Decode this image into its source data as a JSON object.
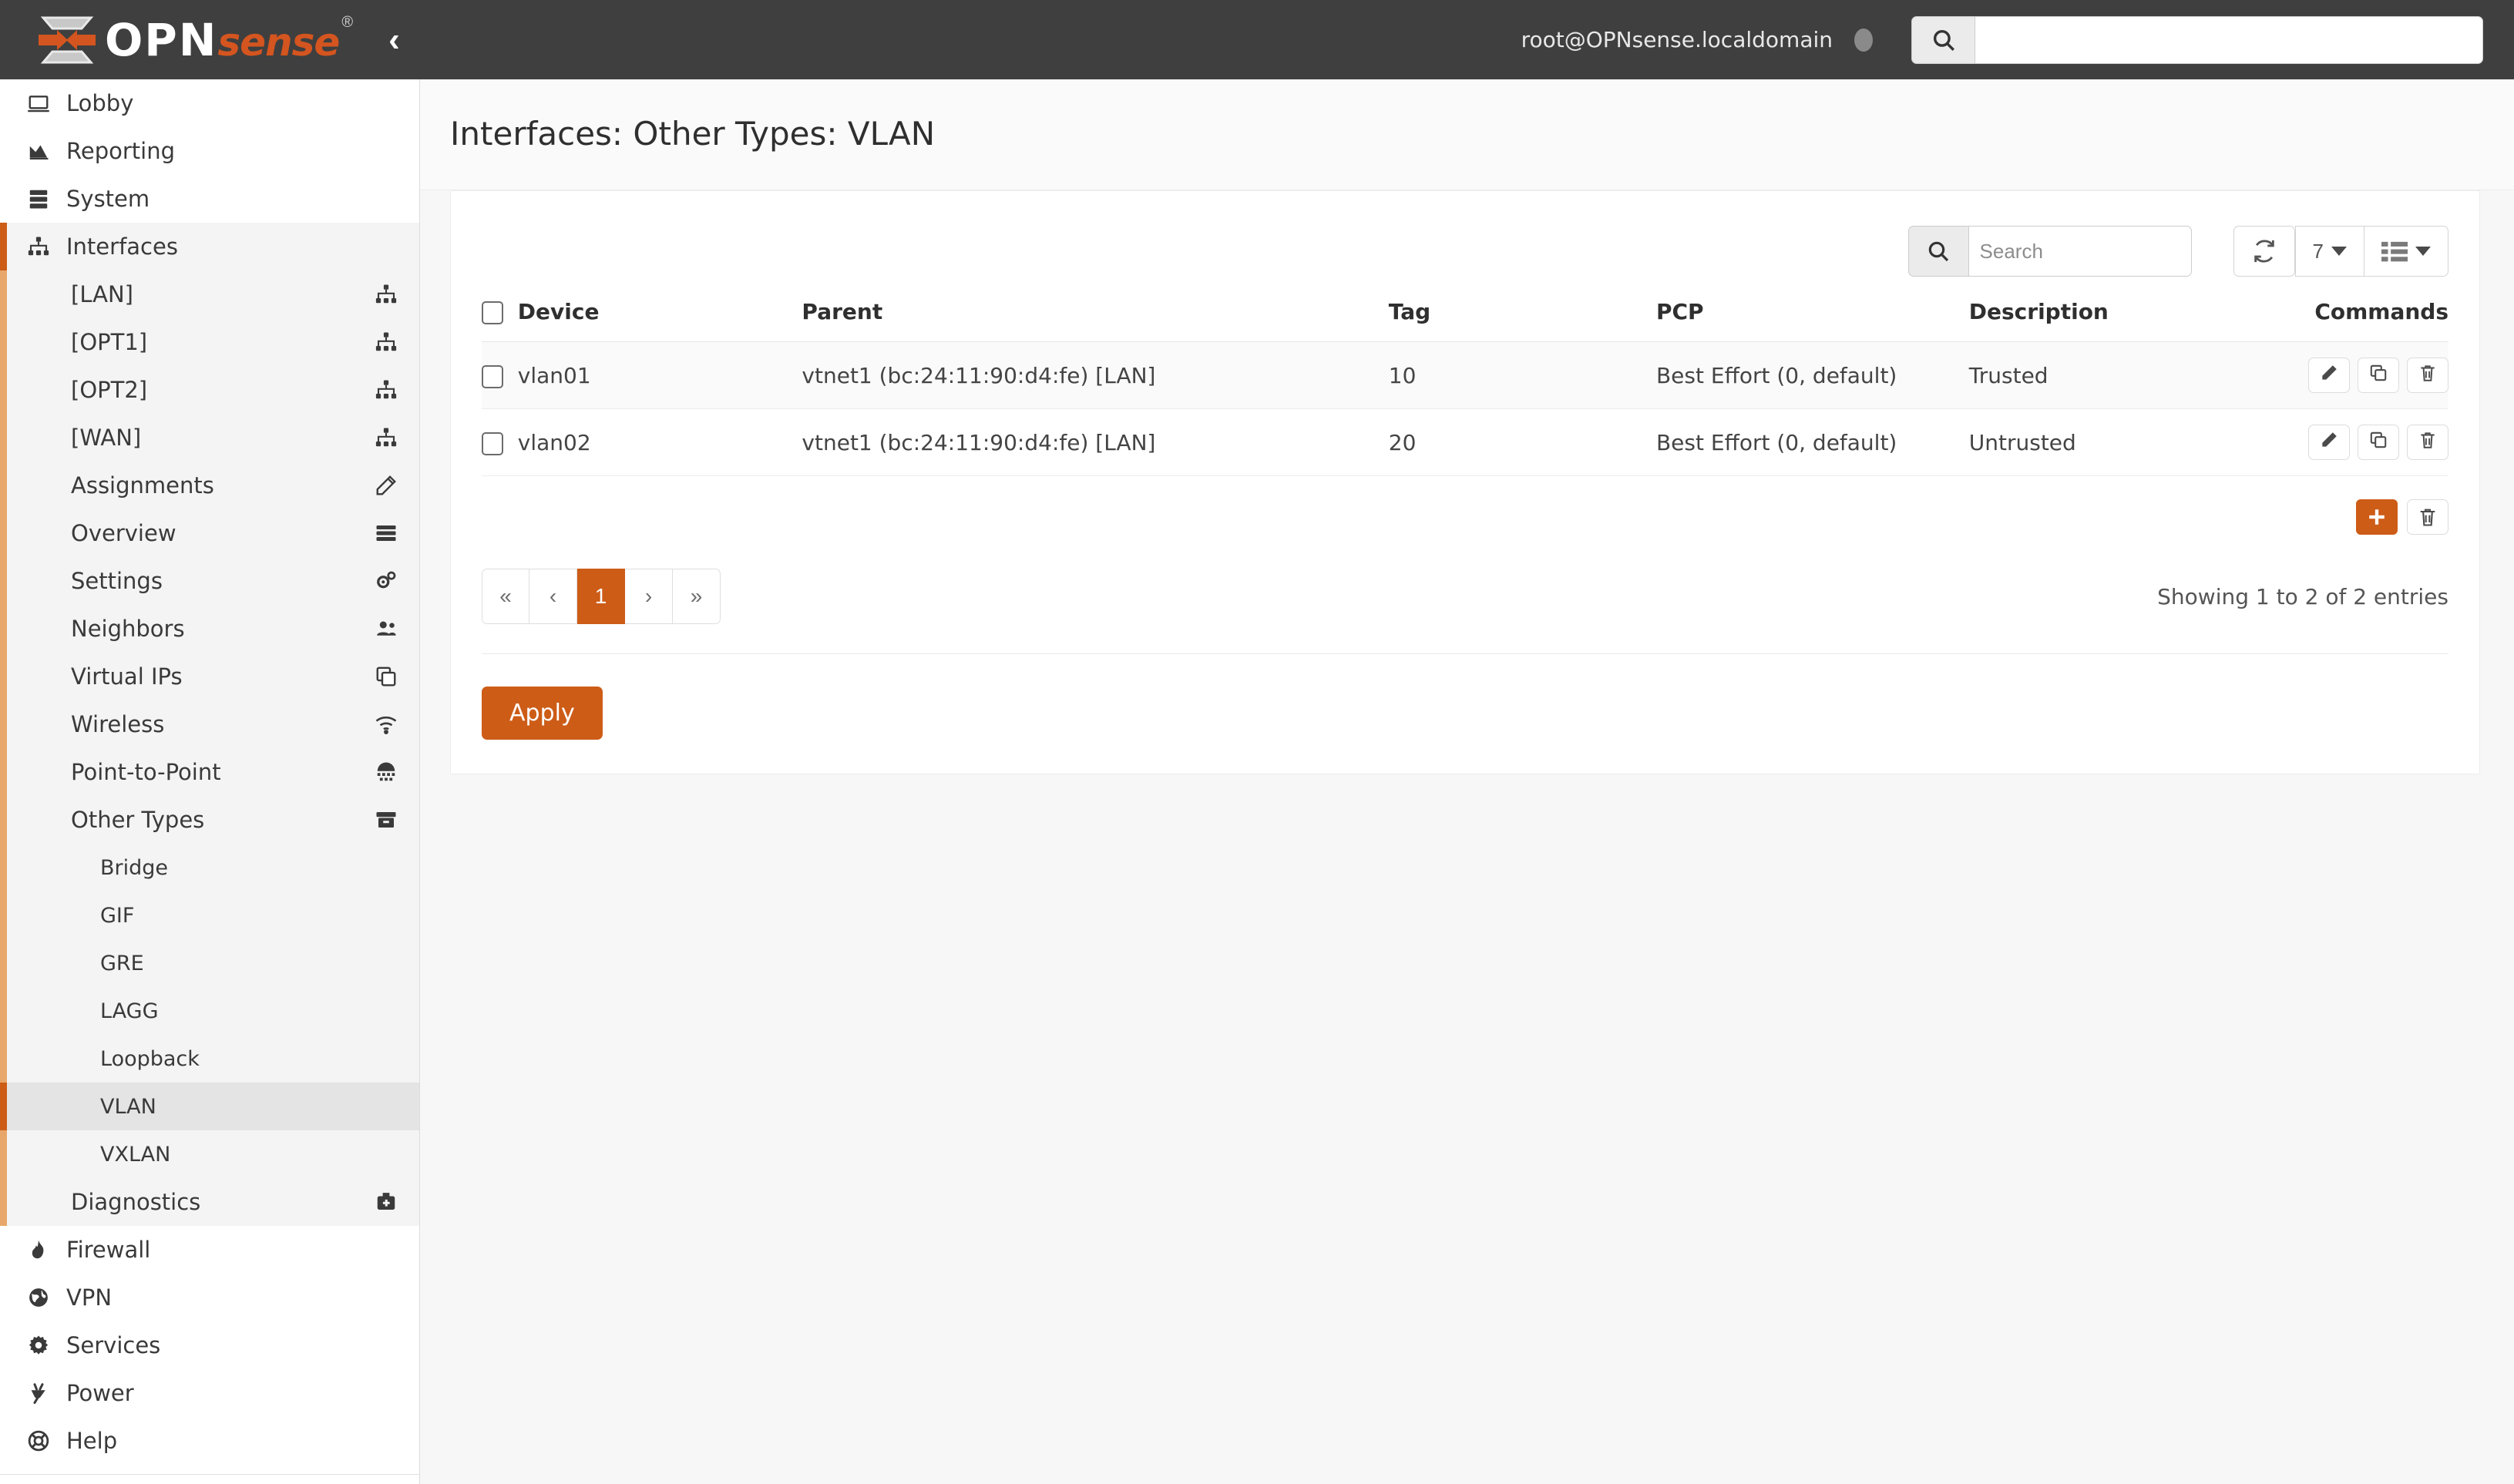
{
  "header": {
    "logo_opn": "OPN",
    "logo_sense": "sense",
    "logo_reg": "®",
    "collapse_icon": "chevron-left-icon",
    "user": "root@OPNsense.localdomain",
    "search_placeholder": "",
    "search_value": "",
    "search_icon": "search-icon",
    "status_icon": "status-dot"
  },
  "sidebar": {
    "items": [
      {
        "label": "Lobby",
        "icon": "laptop-icon",
        "level": 0,
        "state": "normal"
      },
      {
        "label": "Reporting",
        "icon": "chart-area-icon",
        "level": 0,
        "state": "normal"
      },
      {
        "label": "System",
        "icon": "server-icon",
        "level": 0,
        "state": "normal"
      },
      {
        "label": "Interfaces",
        "icon": "sitemap-icon",
        "level": 0,
        "state": "group-active"
      },
      {
        "label": "[LAN]",
        "icon": "sitemap-icon",
        "level": 1,
        "state": "sub"
      },
      {
        "label": "[OPT1]",
        "icon": "sitemap-icon",
        "level": 1,
        "state": "sub"
      },
      {
        "label": "[OPT2]",
        "icon": "sitemap-icon",
        "level": 1,
        "state": "sub"
      },
      {
        "label": "[WAN]",
        "icon": "sitemap-icon",
        "level": 1,
        "state": "sub"
      },
      {
        "label": "Assignments",
        "icon": "pencil-icon",
        "level": 1,
        "state": "sub"
      },
      {
        "label": "Overview",
        "icon": "list-icon",
        "level": 1,
        "state": "sub"
      },
      {
        "label": "Settings",
        "icon": "gears-icon",
        "level": 1,
        "state": "sub"
      },
      {
        "label": "Neighbors",
        "icon": "users-icon",
        "level": 1,
        "state": "sub"
      },
      {
        "label": "Virtual IPs",
        "icon": "copy-icon",
        "level": 1,
        "state": "sub"
      },
      {
        "label": "Wireless",
        "icon": "wifi-icon",
        "level": 1,
        "state": "sub"
      },
      {
        "label": "Point-to-Point",
        "icon": "keypad-icon",
        "level": 1,
        "state": "sub"
      },
      {
        "label": "Other Types",
        "icon": "archive-icon",
        "level": 1,
        "state": "sub"
      },
      {
        "label": "Bridge",
        "icon": "",
        "level": 2,
        "state": "sub"
      },
      {
        "label": "GIF",
        "icon": "",
        "level": 2,
        "state": "sub"
      },
      {
        "label": "GRE",
        "icon": "",
        "level": 2,
        "state": "sub"
      },
      {
        "label": "LAGG",
        "icon": "",
        "level": 2,
        "state": "sub"
      },
      {
        "label": "Loopback",
        "icon": "",
        "level": 2,
        "state": "sub"
      },
      {
        "label": "VLAN",
        "icon": "",
        "level": 2,
        "state": "sub-active"
      },
      {
        "label": "VXLAN",
        "icon": "",
        "level": 2,
        "state": "sub"
      },
      {
        "label": "Diagnostics",
        "icon": "medkit-icon",
        "level": 1,
        "state": "sub"
      },
      {
        "label": "Firewall",
        "icon": "fire-icon",
        "level": 0,
        "state": "normal"
      },
      {
        "label": "VPN",
        "icon": "globe-icon",
        "level": 0,
        "state": "normal"
      },
      {
        "label": "Services",
        "icon": "gear-icon",
        "level": 0,
        "state": "normal"
      },
      {
        "label": "Power",
        "icon": "plug-icon",
        "level": 0,
        "state": "normal"
      },
      {
        "label": "Help",
        "icon": "lifebuoy-icon",
        "level": 0,
        "state": "normal"
      }
    ]
  },
  "page": {
    "title": "Interfaces: Other Types: VLAN"
  },
  "toolbar": {
    "search_placeholder": "Search",
    "search_value": "",
    "search_icon": "search-icon",
    "refresh_icon": "refresh-icon",
    "page_size": "7",
    "columns_icon": "columns-icon"
  },
  "table": {
    "columns": [
      "Device",
      "Parent",
      "Tag",
      "PCP",
      "Description",
      "Commands"
    ],
    "rows": [
      {
        "device": "vlan01",
        "parent": "vtnet1 (bc:24:11:90:d4:fe) [LAN]",
        "tag": "10",
        "pcp": "Best Effort (0, default)",
        "description": "Trusted",
        "commands": [
          "edit-icon",
          "clone-icon",
          "delete-icon"
        ]
      },
      {
        "device": "vlan02",
        "parent": "vtnet1 (bc:24:11:90:d4:fe) [LAN]",
        "tag": "20",
        "pcp": "Best Effort (0, default)",
        "description": "Untrusted",
        "commands": [
          "edit-icon",
          "clone-icon",
          "delete-icon"
        ]
      }
    ],
    "add_label": "+",
    "add_icon": "plus-icon",
    "delete_selected_icon": "delete-icon"
  },
  "pagination": {
    "first": "«",
    "prev": "‹",
    "pages": [
      "1"
    ],
    "current": "1",
    "next": "›",
    "last": "»",
    "entries_text": "Showing 1 to 2 of 2 entries"
  },
  "actions": {
    "apply_label": "Apply"
  },
  "colors": {
    "accent": "#cd5c17",
    "accent_light": "#e8a76a",
    "topbar": "#3f3f3f",
    "page_bg": "#f7f7f7"
  }
}
